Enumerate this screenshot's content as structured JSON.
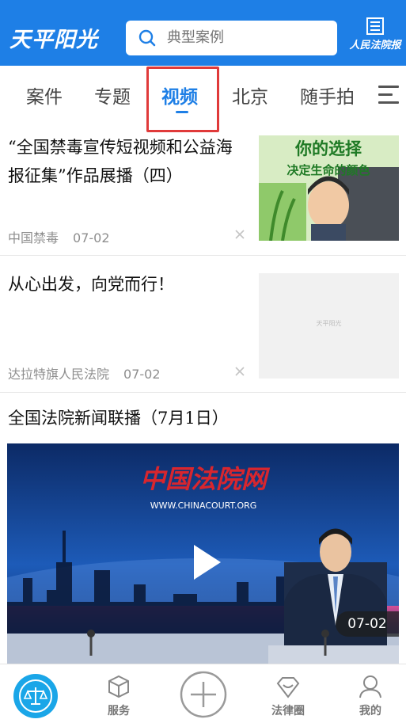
{
  "header": {
    "logo_text": "天平阳光",
    "search_placeholder": "典型案例",
    "paper_logo_text": "人民法院报"
  },
  "tabs": [
    {
      "label": "案件",
      "active": false
    },
    {
      "label": "专题",
      "active": false
    },
    {
      "label": "视频",
      "active": true
    },
    {
      "label": "北京",
      "active": false
    },
    {
      "label": "随手拍",
      "active": false
    }
  ],
  "feed": {
    "items": [
      {
        "title": "“全国禁毒宣传短视频和公益海报征集”作品展播（四）",
        "source": "中国禁毒",
        "date": "07-02",
        "thumb_line1": "你的选择",
        "thumb_line2": "决定生命的颜色"
      },
      {
        "title": "从心出发，向党而行！",
        "source": "达拉特旗人民法院",
        "date": "07-02",
        "thumb_placeholder": "天平阳光"
      }
    ],
    "video": {
      "title": "全国法院新闻联播（7月1日）",
      "banner_text": "中国法院网",
      "banner_url": "WWW.CHINACOURT.ORG",
      "date": "07-02"
    }
  },
  "bottom_nav": [
    {
      "label": "",
      "icon": "scales-icon"
    },
    {
      "label": "服务",
      "icon": "cube-icon"
    },
    {
      "label": "",
      "icon": "plus-icon"
    },
    {
      "label": "法律圈",
      "icon": "diamond-icon"
    },
    {
      "label": "我的",
      "icon": "user-icon"
    }
  ],
  "colors": {
    "brand_blue": "#1e7fe6",
    "highlight_red": "#e03a3a"
  }
}
